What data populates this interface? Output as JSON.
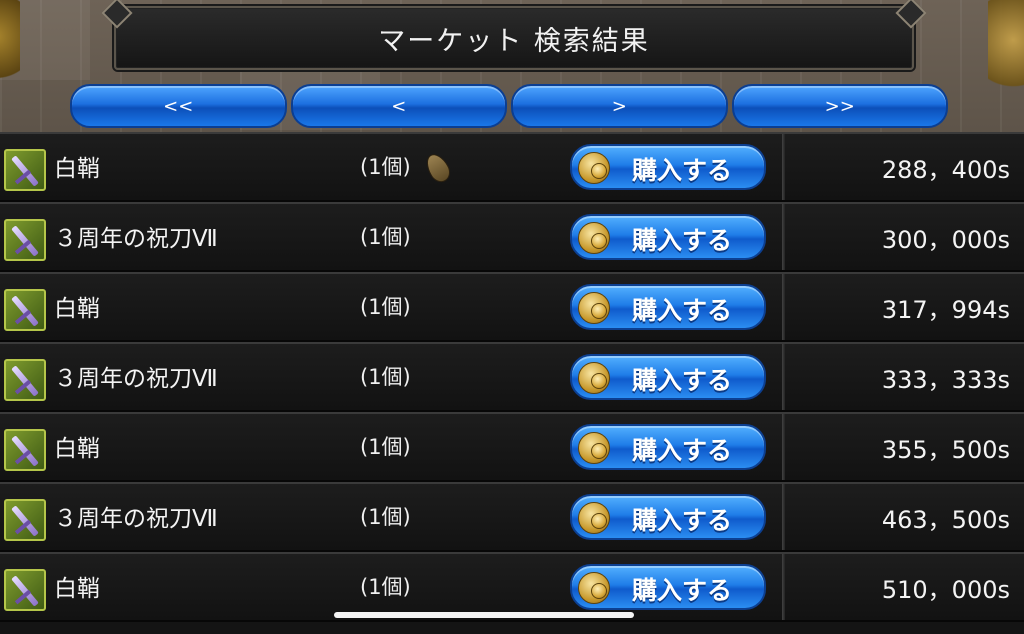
{
  "header": {
    "title": "マーケット 検索結果"
  },
  "pager": {
    "first": "<<",
    "prev": "<",
    "next": ">",
    "last": ">>"
  },
  "buy_label": "購入する",
  "rows": [
    {
      "name": "白鞘",
      "qty": "(1個)",
      "price": "288，400s",
      "icon": "sword-icon",
      "extra_icon": "seed-icon"
    },
    {
      "name": "３周年の祝刀Ⅶ",
      "qty": "(1個)",
      "price": "300，000s",
      "icon": "sword-icon"
    },
    {
      "name": "白鞘",
      "qty": "(1個)",
      "price": "317，994s",
      "icon": "sword-icon"
    },
    {
      "name": "３周年の祝刀Ⅶ",
      "qty": "(1個)",
      "price": "333，333s",
      "icon": "sword-icon"
    },
    {
      "name": "白鞘",
      "qty": "(1個)",
      "price": "355，500s",
      "icon": "sword-icon"
    },
    {
      "name": "３周年の祝刀Ⅶ",
      "qty": "(1個)",
      "price": "463，500s",
      "icon": "sword-icon"
    },
    {
      "name": "白鞘",
      "qty": "(1個)",
      "price": "510，000s",
      "icon": "sword-icon"
    }
  ],
  "colors": {
    "button_blue": "#1c6fe0",
    "row_bg": "#1a1a1a",
    "text": "#f3f3f3"
  }
}
